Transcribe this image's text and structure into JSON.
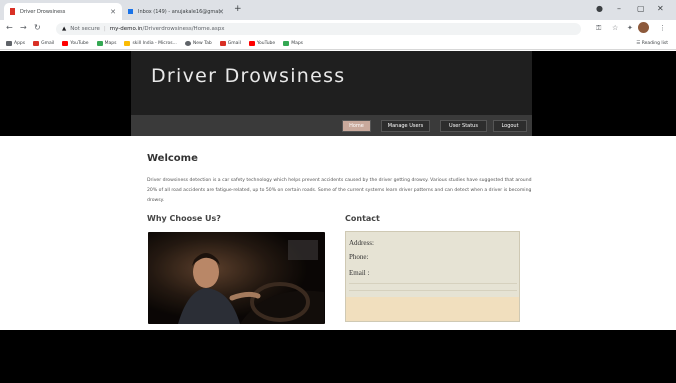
{
  "browser": {
    "tabs": [
      {
        "title": "Driver Drowsiness",
        "favicon_color": "#d93025"
      },
      {
        "title": "Inbox (149) - anujakale16@gmai",
        "favicon_color": "#1a73e8"
      }
    ],
    "new_tab_glyph": "+",
    "url": {
      "warning_icon": "warning-icon",
      "security_label": "Not secure",
      "domain": "my-demo.in",
      "path": "/Driverdrowsiness/Home.aspx"
    },
    "bookmarks": [
      {
        "label": "Apps",
        "color": "#5f6368"
      },
      {
        "label": "Gmail",
        "color": "#d93025"
      },
      {
        "label": "YouTube",
        "color": "#ff0000"
      },
      {
        "label": "Maps",
        "color": "#34a853"
      },
      {
        "label": "skill India - Micros...",
        "color": "#fbbc04"
      },
      {
        "label": "New Tab",
        "color": "#5f6368"
      },
      {
        "label": "Gmail",
        "color": "#d93025"
      },
      {
        "label": "YouTube",
        "color": "#ff0000"
      },
      {
        "label": "Maps",
        "color": "#34a853"
      }
    ],
    "reading_list": "Reading list"
  },
  "site": {
    "title": "Driver Drowsiness",
    "nav": [
      {
        "label": "Home",
        "active": true
      },
      {
        "label": "Manage Users",
        "active": false
      },
      {
        "label": "User Status",
        "active": false
      },
      {
        "label": "Logout",
        "active": false
      }
    ],
    "welcome_heading": "Welcome",
    "intro_text": "Driver drowsiness detection is a car safety technology which helps prevent accidents caused by the driver getting drowsy. Various studies have suggested that around 20% of all road accidents are fatigue-related, up to 50% on certain roads. Some of the current systems learn driver patterns and can detect when a driver is becoming drowsy.",
    "why_heading": "Why Choose Us?",
    "contact_heading": "Contact",
    "contact": {
      "address_label": "Address:",
      "phone_label": "Phone:",
      "email_label": "Email :"
    }
  },
  "colors": {
    "banner": "#1f1f1f",
    "navbar": "#3a3a3a",
    "active_nav": "#c9a99c",
    "contact_bg": "#e6e3d4",
    "contact_footer": "#f1dfbe"
  }
}
